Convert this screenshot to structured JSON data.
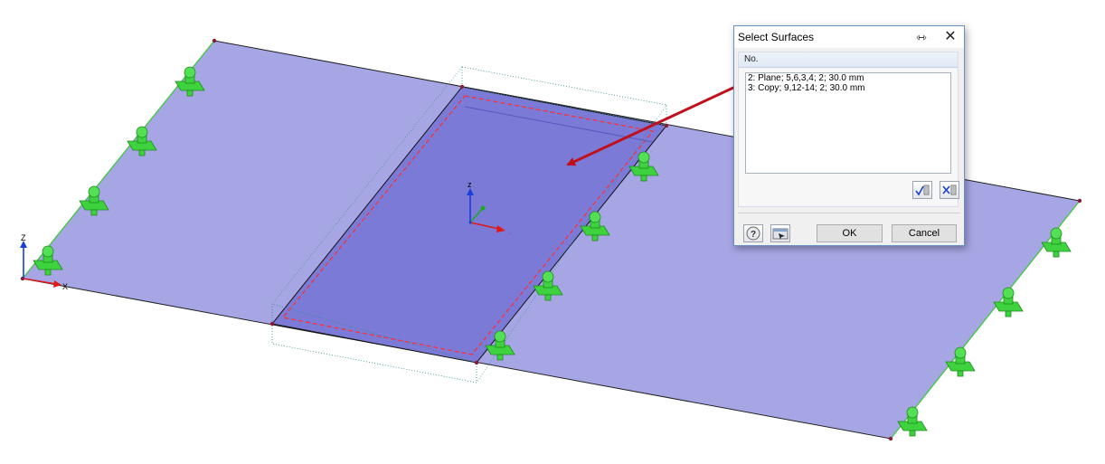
{
  "dialog": {
    "title": "Select Surfaces",
    "column_header": "No.",
    "items": [
      "2: Plane; 5,6,3,4; 2; 30.0 mm",
      "3: Copy; 9,12-14; 2; 30.0 mm"
    ],
    "ok_label": "OK",
    "cancel_label": "Cancel"
  },
  "axes": {
    "global": {
      "z": "Z",
      "x": "X"
    },
    "local": {
      "z": "z"
    }
  },
  "colors": {
    "outer_plate": "#a7a6e4",
    "inner_plate": "#7b7ad6",
    "support": "#3ed33e",
    "highlight": "#ff2d2d",
    "arrow": "#c0101c",
    "dialog_border": "#6a8fc2"
  },
  "icons": [
    "pin-icon",
    "close-icon",
    "select-all-icon",
    "deselect-all-icon",
    "help-icon",
    "pick-in-view-icon"
  ]
}
